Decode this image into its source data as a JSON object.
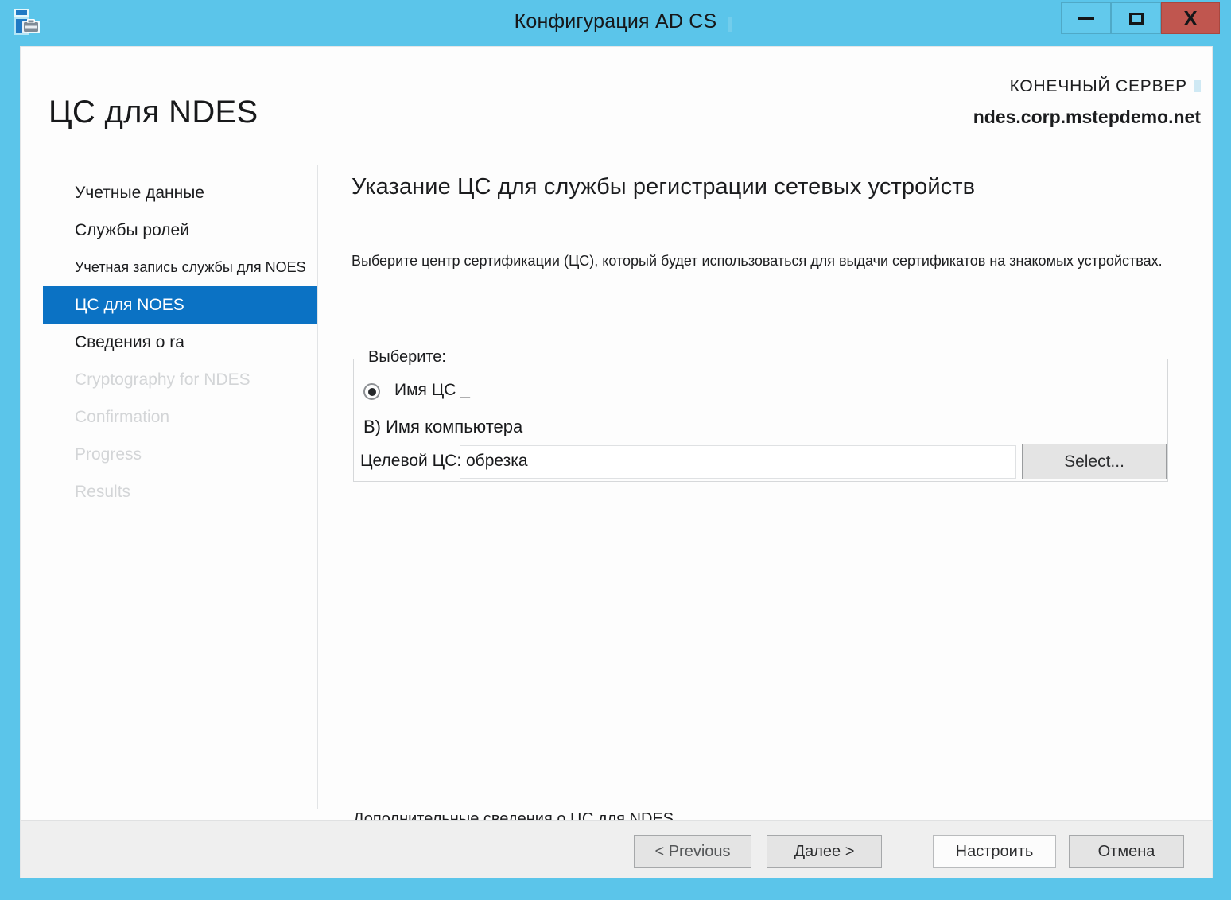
{
  "window": {
    "title": "Конфигурация AD CS",
    "app_icon": "server-wizard-icon",
    "controls": {
      "minimize": "minimize-icon",
      "maximize": "maximize-icon",
      "close": "X"
    },
    "frame_color": "#5bc5ea",
    "close_color": "#c0564f"
  },
  "header": {
    "page_title": "ЦС для NDES",
    "destination_label": "КОНЕЧНЫЙ СЕРВЕР",
    "destination_server": "ndes.corp.mstepdemo.net"
  },
  "sidebar": {
    "items": [
      {
        "label": "Учетные данные",
        "state": "enabled"
      },
      {
        "label": "Службы ролей",
        "state": "enabled"
      },
      {
        "label": "Учетная запись службы для NOES",
        "state": "enabled"
      },
      {
        "label": "ЦС для NOES",
        "state": "active"
      },
      {
        "label": "Сведения о ra",
        "state": "enabled"
      },
      {
        "label": "Cryptography for NDES",
        "state": "disabled"
      },
      {
        "label": "Confirmation",
        "state": "disabled"
      },
      {
        "label": "Progress",
        "state": "disabled"
      },
      {
        "label": "Results",
        "state": "disabled"
      }
    ],
    "active_background": "#0b72c4"
  },
  "main": {
    "heading": "Указание ЦС для службы регистрации сетевых устройств",
    "description": "Выберите центр сертификации (ЦС), который будет использоваться для выдачи сертификатов на знакомых устройствах.",
    "groupbox": {
      "legend": "Выберите:",
      "radio_label": "Имя ЦС _",
      "radio_selected": true,
      "option_b_label": "B) Имя компьютера",
      "field_overlay_label": "Целевой ЦС: обрезка",
      "field_value": "",
      "field_placeholder": "",
      "select_button": "Select..."
    },
    "more_info_link": "Дополнительные сведения о ЦС для NDES"
  },
  "footer": {
    "previous": "< Previous",
    "next": "Далее >",
    "configure": "Настроить",
    "cancel": "Отмена"
  }
}
